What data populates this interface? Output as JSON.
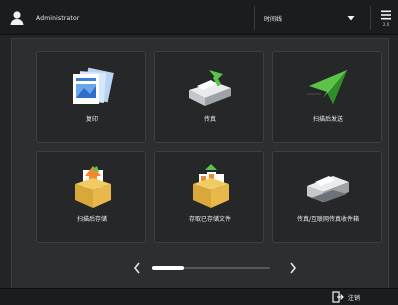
{
  "header": {
    "user_name": "Administrator",
    "dropdown_value": "时间线",
    "menu_caption": "2.0"
  },
  "tiles": [
    {
      "label": "复印"
    },
    {
      "label": "传真"
    },
    {
      "label": "扫描后发送"
    },
    {
      "label": "扫描后存储"
    },
    {
      "label": "存取已存储文件"
    },
    {
      "label": "传真/互联网传真收件箱"
    }
  ],
  "footer": {
    "logout_label": "注销"
  },
  "pager": {
    "position": 0.0
  },
  "colors": {
    "background": "#232426",
    "panel": "#2d2e31",
    "tile": "#262729",
    "accent_green": "#5cc24a",
    "accent_orange": "#f08a2a"
  }
}
